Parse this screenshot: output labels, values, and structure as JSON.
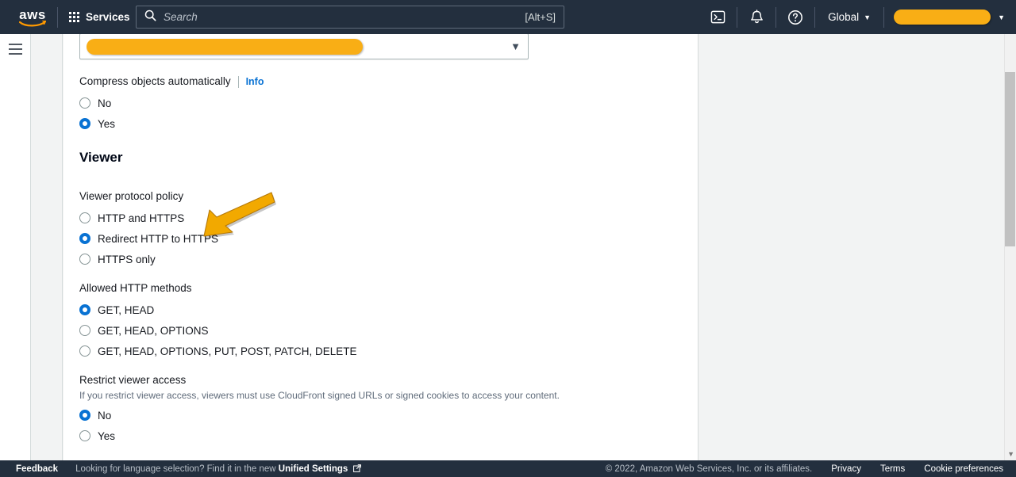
{
  "topnav": {
    "logo_alt": "aws",
    "services_label": "Services",
    "search_placeholder": "Search",
    "search_shortcut": "[Alt+S]",
    "cloudshell_icon": "cloudshell-terminal-icon",
    "notifications_icon": "bell-icon",
    "help_icon": "question-circle-icon",
    "region_label": "Global",
    "region_caret": "▼",
    "account_caret": "▼",
    "account_redacted": ""
  },
  "sidebar": {
    "menu_icon": "hamburger-menu-icon"
  },
  "form": {
    "select_caret": "▼",
    "select_value_redacted": "",
    "compress": {
      "label": "Compress objects automatically",
      "info_label": "Info",
      "options": [
        {
          "label": "No",
          "selected": false
        },
        {
          "label": "Yes",
          "selected": true
        }
      ]
    },
    "viewer_section_title": "Viewer",
    "viewer_protocol": {
      "label": "Viewer protocol policy",
      "options": [
        {
          "label": "HTTP and HTTPS",
          "selected": false
        },
        {
          "label": "Redirect HTTP to HTTPS",
          "selected": true
        },
        {
          "label": "HTTPS only",
          "selected": false
        }
      ]
    },
    "allowed_methods": {
      "label": "Allowed HTTP methods",
      "options": [
        {
          "label": "GET, HEAD",
          "selected": true
        },
        {
          "label": "GET, HEAD, OPTIONS",
          "selected": false
        },
        {
          "label": "GET, HEAD, OPTIONS, PUT, POST, PATCH, DELETE",
          "selected": false
        }
      ]
    },
    "restrict_viewer_access": {
      "label": "Restrict viewer access",
      "description": "If you restrict viewer access, viewers must use CloudFront signed URLs or signed cookies to access your content.",
      "options": [
        {
          "label": "No",
          "selected": true
        },
        {
          "label": "Yes",
          "selected": false
        }
      ]
    }
  },
  "annotation": {
    "arrow_icon": "arrow-pointing-down-left",
    "target": "Redirect HTTP to HTTPS",
    "color": "#F2A900"
  },
  "footer": {
    "feedback": "Feedback",
    "language_note": "Looking for language selection? Find it in the new",
    "unified_settings": "Unified Settings",
    "external_icon": "external-link-icon",
    "copyright": "© 2022, Amazon Web Services, Inc. or its affiliates.",
    "privacy": "Privacy",
    "terms": "Terms",
    "cookie_preferences": "Cookie preferences"
  },
  "colors": {
    "nav_background": "#232f3e",
    "accent_blue": "#0972d3",
    "redaction_yellow": "#f9ae15",
    "annotation_yellow": "#F2A900"
  }
}
